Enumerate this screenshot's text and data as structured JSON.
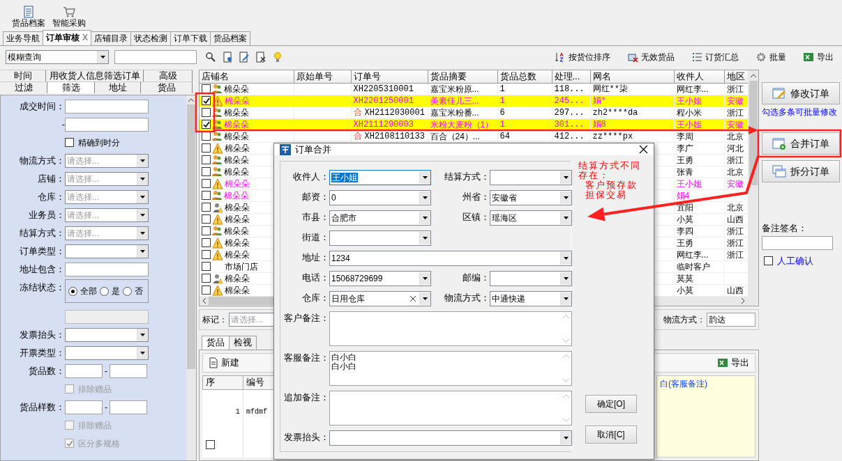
{
  "top_toolbar": [
    {
      "label": "货品档案"
    },
    {
      "label": "智能采购"
    }
  ],
  "tabs": [
    {
      "label": "业务导航",
      "selected": false
    },
    {
      "label": "订单审核",
      "selected": true,
      "close": "X"
    },
    {
      "label": "店铺目录",
      "selected": false
    },
    {
      "label": "状态检测",
      "selected": false
    },
    {
      "label": "订单下载",
      "selected": false
    },
    {
      "label": "货品档案",
      "selected": false
    }
  ],
  "search_bar": {
    "mode": "模糊查询"
  },
  "actions": [
    {
      "label": "按货位排序"
    },
    {
      "label": "无效货品"
    },
    {
      "label": "订货汇总"
    },
    {
      "label": "批量"
    },
    {
      "label": "导出"
    }
  ],
  "filter_tabs": [
    [
      {
        "label": "时间",
        "selected": false
      },
      {
        "label": "用收货人信息筛选订单",
        "selected": false
      },
      {
        "label": "高级",
        "selected": false
      }
    ],
    [
      {
        "label": "过滤",
        "selected": false
      },
      {
        "label": "筛选",
        "selected": true
      },
      {
        "label": "地址",
        "selected": false
      },
      {
        "label": "货品",
        "selected": false
      }
    ]
  ],
  "filter_form": [
    {
      "kind": "text",
      "label": "成交时间："
    },
    {
      "kind": "text",
      "label": "-"
    },
    {
      "kind": "check",
      "label": "精确到时分",
      "checked": false,
      "disabled": false
    },
    {
      "kind": "select",
      "label": "物流方式：",
      "placeholder": "请选择..."
    },
    {
      "kind": "select",
      "label": "店铺：",
      "placeholder": "请选择..."
    },
    {
      "kind": "select",
      "label": "仓库：",
      "placeholder": "请选择..."
    },
    {
      "kind": "select",
      "label": "业务员：",
      "placeholder": "请选择..."
    },
    {
      "kind": "select",
      "label": "结算方式：",
      "placeholder": "请选择..."
    },
    {
      "kind": "select",
      "label": "订单类型："
    },
    {
      "kind": "text",
      "label": "地址包含："
    },
    {
      "kind": "radio",
      "label": "冻结状态：",
      "options": [
        {
          "label": "全部",
          "selected": true
        },
        {
          "label": "是",
          "selected": false
        },
        {
          "label": "否",
          "selected": false
        }
      ]
    },
    {
      "kind": "blank"
    },
    {
      "kind": "select",
      "label": "发票抬头："
    },
    {
      "kind": "select",
      "label": "开票类型："
    },
    {
      "kind": "range",
      "label": "货品数：",
      "separator": "-"
    },
    {
      "kind": "check",
      "label": "排除赠品",
      "checked": false,
      "disabled": true
    },
    {
      "kind": "range",
      "label": "货品样数：",
      "separator": "-"
    },
    {
      "kind": "check",
      "label": "排除赠品",
      "checked": false,
      "disabled": true
    },
    {
      "kind": "check",
      "label": "区分多规格",
      "checked": true,
      "disabled": true
    }
  ],
  "grid": {
    "columns": [
      "店铺名",
      "原始单号",
      "订单号",
      "货品摘要",
      "货品总数",
      "处理...",
      "网名",
      "收件人",
      "地区"
    ],
    "rows": [
      {
        "kind": "people",
        "checked": false,
        "highlighted": false,
        "magenta": false,
        "store": "棉朵朵",
        "order_no": "XH2205310001",
        "summary": "嘉宝米粉原...",
        "qty": "1",
        "processed": "118...",
        "nick": "网红**柒",
        "receiver": "网红李...",
        "region": "浙江"
      },
      {
        "kind": "warning",
        "checked": true,
        "highlighted": true,
        "magenta": true,
        "store": "棉朵朵",
        "order_no": "XH2201250001",
        "summary": "美素佳儿三...",
        "qty": "1",
        "processed": "245...",
        "nick": "娟*",
        "receiver": "王小姐",
        "region": "安徽"
      },
      {
        "kind": "people",
        "checked": false,
        "highlighted": false,
        "magenta": false,
        "store": "棉朵朵",
        "order_mark": "合",
        "order_no": "XH2112030001",
        "summary": "嘉宝米粉番...",
        "qty": "6",
        "processed": "297...",
        "nick": "zh2****da",
        "receiver": "程小米",
        "region": "浙江"
      },
      {
        "kind": "people",
        "checked": true,
        "highlighted": true,
        "magenta": true,
        "store": "棉朵朵",
        "order_no": "XH2111290003",
        "summary": "米粉大麦粉（1）",
        "qty": "1",
        "processed": "301...",
        "nick": "娟8",
        "receiver": "王小姐",
        "region": "安徽"
      },
      {
        "kind": "people",
        "checked": false,
        "highlighted": false,
        "magenta": false,
        "store": "棉朵朵",
        "order_mark": "合",
        "order_no": "XH2108110133",
        "summary": "百合（24）...",
        "qty": "64",
        "processed": "412...",
        "nick": "zz****px",
        "receiver": "李周",
        "region": "北京"
      },
      {
        "kind": "warning",
        "checked": false,
        "highlighted": false,
        "magenta": false,
        "store": "棉朵朵",
        "receiver": "李广",
        "region": "河北"
      },
      {
        "kind": "people",
        "checked": false,
        "highlighted": false,
        "magenta": false,
        "store": "棉朵朵",
        "receiver": "王勇",
        "region": "浙江"
      },
      {
        "kind": "people",
        "checked": false,
        "highlighted": false,
        "magenta": false,
        "store": "棉朵朵",
        "receiver": "张青",
        "region": "北京"
      },
      {
        "kind": "warning",
        "checked": false,
        "highlighted": false,
        "magenta": true,
        "store": "棉朵朵",
        "receiver": "王小姐",
        "region": "安徽"
      },
      {
        "kind": "people",
        "checked": false,
        "highlighted": false,
        "magenta": true,
        "store": "棉朵朵",
        "receiver": "娟4"
      },
      {
        "kind": "user",
        "checked": false,
        "highlighted": false,
        "magenta": false,
        "store": "棉朵朵",
        "receiver": "宜阳",
        "region": "北京"
      },
      {
        "kind": "warning",
        "checked": false,
        "highlighted": false,
        "magenta": false,
        "store": "棉朵朵",
        "receiver": "小莫",
        "region": "山西"
      },
      {
        "kind": "people",
        "checked": false,
        "highlighted": false,
        "magenta": false,
        "store": "棉朵朵",
        "receiver": "李四",
        "region": "浙江"
      },
      {
        "kind": "warning",
        "checked": false,
        "highlighted": false,
        "magenta": false,
        "store": "棉朵朵",
        "receiver": "王勇",
        "region": "浙江"
      },
      {
        "kind": "warning",
        "checked": false,
        "highlighted": false,
        "magenta": false,
        "store": "棉朵朵",
        "receiver": "网红李...",
        "region": "浙江"
      },
      {
        "kind": "plain",
        "checked": false,
        "highlighted": false,
        "magenta": false,
        "store": "市场门店",
        "receiver": "临时客户"
      },
      {
        "kind": "user",
        "checked": false,
        "highlighted": false,
        "magenta": false,
        "store": "棉朵朵",
        "receiver": "莫莫"
      },
      {
        "kind": "warning",
        "checked": false,
        "highlighted": false,
        "magenta": false,
        "store": "棉朵朵",
        "receiver": "小莫",
        "region": "山西"
      }
    ]
  },
  "mark_bar": {
    "label": "标记：",
    "placeholder": "请选择...",
    "logistics_label": "物流方式：",
    "logistics_value": "韵达"
  },
  "detail": {
    "tabs": [
      {
        "label": "货品",
        "selected": true
      },
      {
        "label": "检视",
        "selected": false
      }
    ],
    "new_label": "新建",
    "export_label": "导出",
    "columns": [
      "序",
      "编号"
    ],
    "rows": [
      {
        "index": "1",
        "code": "mfdmf",
        "checked": false
      }
    ],
    "note": "白(客服备注)"
  },
  "right_panel": {
    "edit": "修改订单",
    "hint": "勾选多条可批量修改",
    "merge": "合并订单",
    "split": "拆分订单",
    "sign_label": "备注签名：",
    "manual": {
      "label": "人工确认",
      "checked": false
    }
  },
  "dialog": {
    "title": "订单合并",
    "fields": [
      {
        "kind": "combo",
        "label": "收件人：",
        "value": "王小姐",
        "text_selected": true
      },
      {
        "kind": "combo",
        "label": "结算方式："
      },
      {
        "kind": "combo",
        "label": "邮资：",
        "value": "0"
      },
      {
        "kind": "combo",
        "label": "州省：",
        "value": "安徽省"
      },
      {
        "kind": "combo",
        "label": "市县：",
        "value": "合肥市"
      },
      {
        "kind": "combo",
        "label": "区镇：",
        "value": "瑶海区"
      },
      {
        "kind": "combo",
        "label": "街道："
      },
      {
        "kind": "wide",
        "label": "地址：",
        "value": "1234"
      },
      {
        "kind": "combo",
        "label": "电话：",
        "value": "15068729699"
      },
      {
        "kind": "combo",
        "label": "邮编："
      },
      {
        "kind": "clear",
        "label": "仓库：",
        "value": "日用仓库"
      },
      {
        "kind": "combo",
        "label": "物流方式：",
        "value": "中通快递"
      },
      {
        "kind": "memo",
        "label": "客户备注："
      },
      {
        "kind": "memo",
        "label": "客服备注：",
        "lines": [
          "白小白",
          "白小白"
        ]
      },
      {
        "kind": "memo",
        "label": "追加备注："
      },
      {
        "kind": "wide",
        "label": "发票抬头："
      }
    ],
    "warning": {
      "heading": "结算方式不同存在：",
      "items": [
        "客户预存款",
        "担保交易"
      ]
    },
    "ok": "确定[O]",
    "cancel": "取消[C]"
  }
}
